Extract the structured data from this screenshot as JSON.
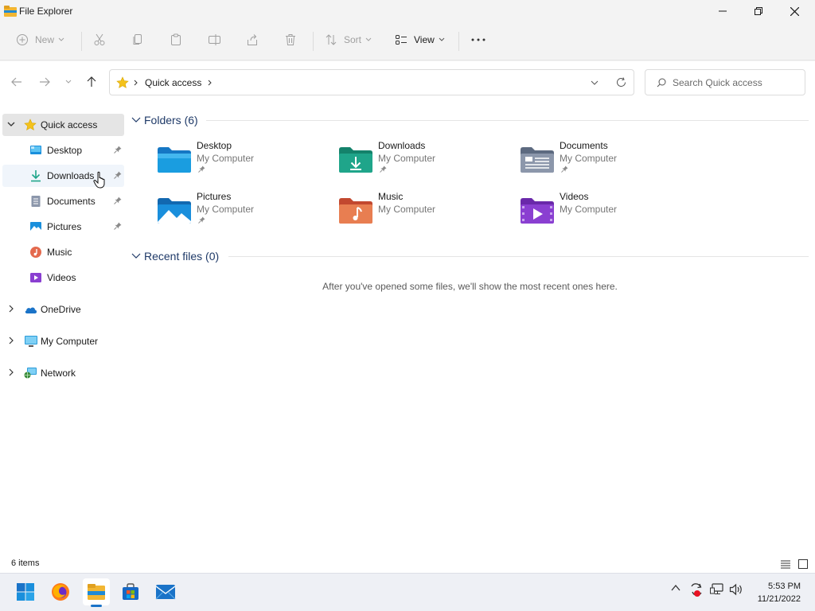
{
  "window": {
    "title": "File Explorer"
  },
  "toolbar": {
    "new_label": "New",
    "sort_label": "Sort",
    "view_label": "View"
  },
  "address": {
    "location": "Quick access"
  },
  "search": {
    "placeholder": "Search Quick access"
  },
  "sidebar": {
    "items": [
      {
        "label": "Quick access"
      },
      {
        "label": "Desktop"
      },
      {
        "label": "Downloads"
      },
      {
        "label": "Documents"
      },
      {
        "label": "Pictures"
      },
      {
        "label": "Music"
      },
      {
        "label": "Videos"
      },
      {
        "label": "OneDrive"
      },
      {
        "label": "My Computer"
      },
      {
        "label": "Network"
      }
    ]
  },
  "main": {
    "folders_header": "Folders (6)",
    "recent_header": "Recent files (0)",
    "empty_message": "After you've opened some files, we'll show the most recent ones here.",
    "folders": [
      {
        "name": "Desktop",
        "location": "My Computer",
        "icon": "desktop-folder-icon",
        "color": "#1a9de0"
      },
      {
        "name": "Downloads",
        "location": "My Computer",
        "icon": "downloads-folder-icon",
        "color": "#1fa58a"
      },
      {
        "name": "Documents",
        "location": "My Computer",
        "icon": "documents-folder-icon",
        "color": "#7b8aa3"
      },
      {
        "name": "Pictures",
        "location": "My Computer",
        "icon": "pictures-folder-icon",
        "color": "#1a8fdc"
      },
      {
        "name": "Music",
        "location": "My Computer",
        "icon": "music-folder-icon",
        "color": "#e46a4e"
      },
      {
        "name": "Videos",
        "location": "My Computer",
        "icon": "videos-folder-icon",
        "color": "#8a3fd1"
      }
    ]
  },
  "status": {
    "item_count": "6 items"
  },
  "clock": {
    "time": "5:53 PM",
    "date": "11/21/2022"
  },
  "colors": {
    "accent": "#1a73c8",
    "selected_bg": "#e5e5e5",
    "section_header": "#1f3a68"
  }
}
